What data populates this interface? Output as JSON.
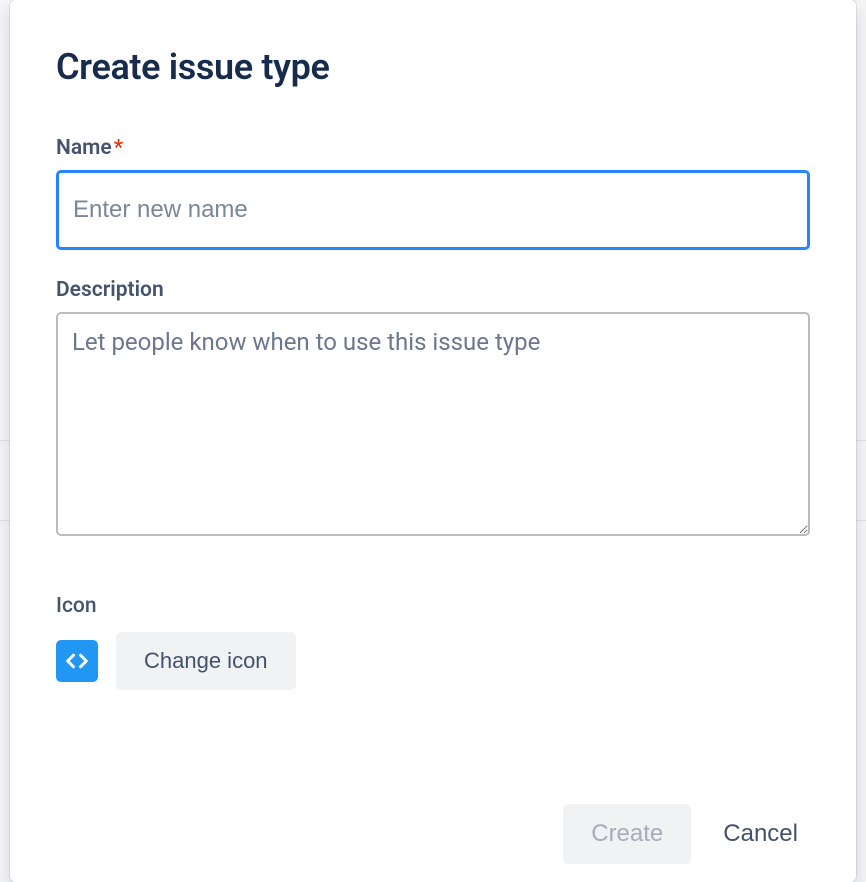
{
  "dialog": {
    "title": "Create issue type",
    "fields": {
      "name": {
        "label": "Name",
        "required_marker": "*",
        "placeholder": "Enter new name",
        "value": ""
      },
      "description": {
        "label": "Description",
        "placeholder": "Let people know when to use this issue type",
        "value": ""
      },
      "icon": {
        "label": "Icon",
        "change_button": "Change icon",
        "current_icon": "code-icon"
      }
    },
    "actions": {
      "primary": "Create",
      "secondary": "Cancel"
    }
  }
}
